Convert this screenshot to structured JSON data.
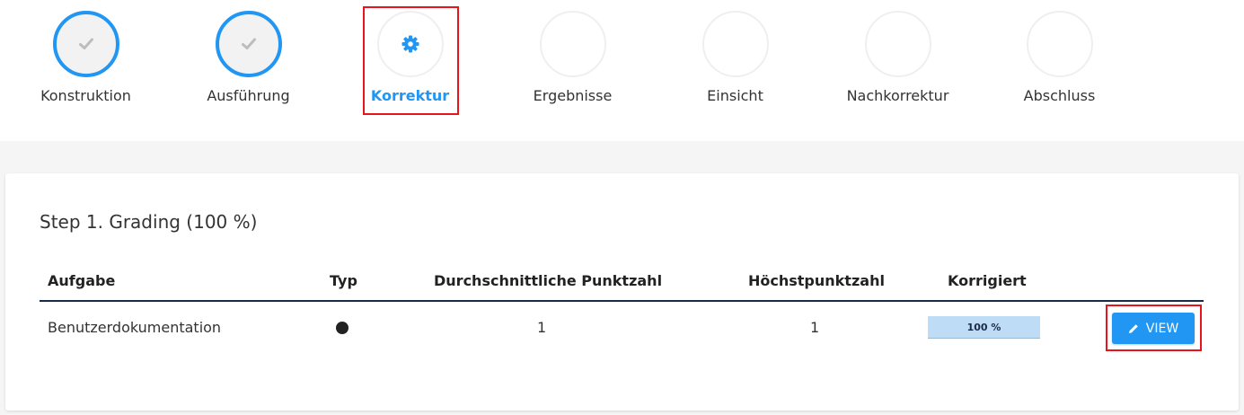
{
  "stepper": {
    "steps": [
      {
        "label": "Konstruktion",
        "state": "done",
        "icon": "check-icon"
      },
      {
        "label": "Ausführung",
        "state": "done",
        "icon": "check-icon"
      },
      {
        "label": "Korrektur",
        "state": "active",
        "icon": "gear-icon"
      },
      {
        "label": "Ergebnisse",
        "state": "pending",
        "icon": ""
      },
      {
        "label": "Einsicht",
        "state": "pending",
        "icon": ""
      },
      {
        "label": "Nachkorrektur",
        "state": "pending",
        "icon": ""
      },
      {
        "label": "Abschluss",
        "state": "pending",
        "icon": ""
      }
    ]
  },
  "card": {
    "title": "Step 1. Grading (100 %)",
    "columns": {
      "task": "Aufgabe",
      "type": "Typ",
      "avg": "Durchschnittliche Punktzahl",
      "max": "Höchstpunktzahl",
      "graded": "Korrigiert"
    },
    "rows": [
      {
        "task": "Benutzerdokumentation",
        "type_icon": "filled-circle-icon",
        "avg": "1",
        "max": "1",
        "graded_label": "100 %",
        "graded_fraction": 1.0,
        "action_label": "VIEW",
        "action_icon": "pencil-icon"
      }
    ]
  },
  "colors": {
    "accent": "#2196f3",
    "highlight": "#e8141b",
    "header_rule": "#1a2b45",
    "progress_bg": "#cfe3f9"
  }
}
